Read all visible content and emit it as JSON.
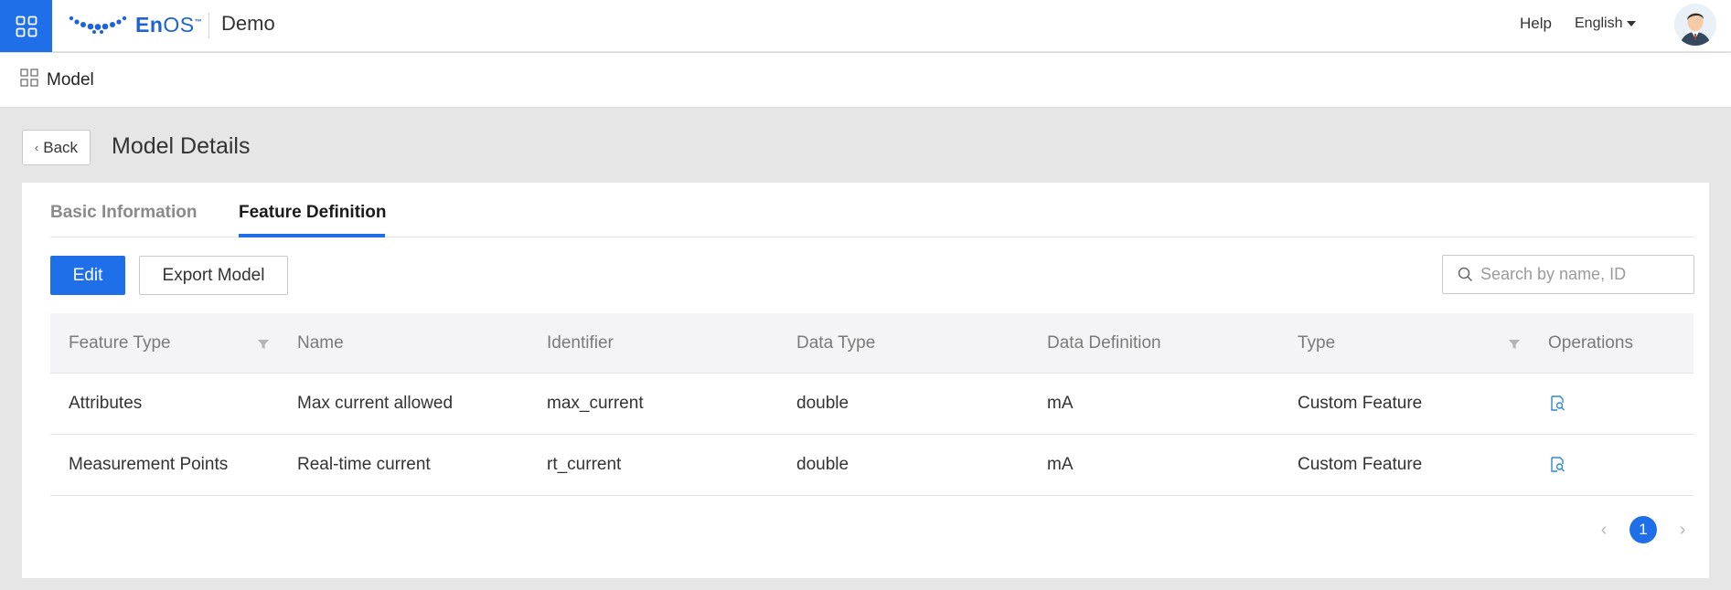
{
  "header": {
    "logo_text_bold": "En",
    "logo_text_light": "OS",
    "logo_tm": "™",
    "app_name": "Demo",
    "help_label": "Help",
    "language": "English"
  },
  "breadcrumb": {
    "label": "Model"
  },
  "page": {
    "back_label": "Back",
    "title": "Model Details"
  },
  "tabs": [
    {
      "label": "Basic Information",
      "active": false
    },
    {
      "label": "Feature Definition",
      "active": true
    }
  ],
  "toolbar": {
    "edit_label": "Edit",
    "export_label": "Export Model",
    "search_placeholder": "Search by name, ID"
  },
  "table": {
    "columns": [
      "Feature Type",
      "Name",
      "Identifier",
      "Data Type",
      "Data Definition",
      "Type",
      "Operations"
    ],
    "rows": [
      [
        "Attributes",
        "Max current allowed",
        "max_current",
        "double",
        "mA",
        "Custom Feature"
      ],
      [
        "Measurement Points",
        "Real-time current",
        "rt_current",
        "double",
        "mA",
        "Custom Feature"
      ]
    ]
  },
  "pagination": {
    "current_page": "1",
    "prev": "‹",
    "next": "›"
  },
  "colors": {
    "primary": "#1f6fe8",
    "background": "#e6e6e6"
  },
  "icons": [
    "apps-grid-icon",
    "enos-logo-icon",
    "user-avatar-icon",
    "model-grid-icon",
    "chevron-left-icon",
    "search-icon",
    "filter-icon",
    "view-detail-icon"
  ]
}
